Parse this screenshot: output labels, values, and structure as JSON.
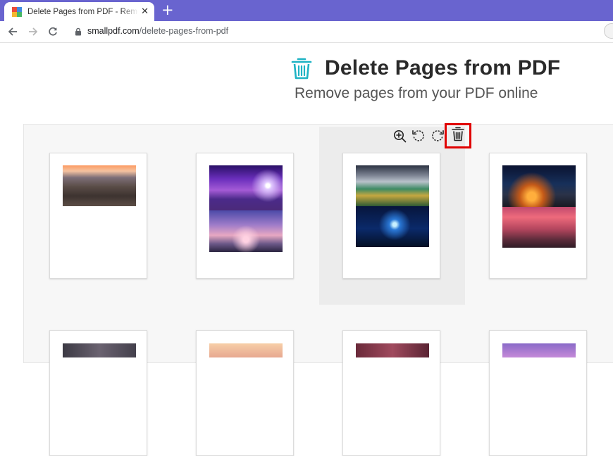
{
  "browser": {
    "tab": {
      "title": "Delete Pages from PDF - Remove",
      "favicon_colors": [
        "#e94b3c",
        "#3f8ae0",
        "#f2b630",
        "#46b765"
      ]
    },
    "new_tab_label": "+",
    "close_label": "✕",
    "address": {
      "domain": "smallpdf.com",
      "path": "/delete-pages-from-pdf"
    },
    "tab_strip_color": "#6964cf"
  },
  "page": {
    "title": "Delete Pages from PDF",
    "subtitle": "Remove pages from your PDF online",
    "accent_color": "#1fb3c4",
    "header_icon": "trash-icon"
  },
  "page_tools": {
    "icons": [
      "zoom-in-icon",
      "rotate-left-icon",
      "rotate-right-icon",
      "trash-icon"
    ],
    "highlight_color": "#e00000"
  },
  "pages": [
    {
      "icon": "landscape-photo",
      "photos": [
        "canyon-sunset"
      ]
    },
    {
      "icon": "landscape-photo",
      "photos": [
        "purple-sea-sunset",
        "pink-lake-rocks"
      ]
    },
    {
      "icon": "landscape-photo",
      "photos": [
        "cloudy-lake",
        "blue-starry-lake"
      ]
    },
    {
      "icon": "landscape-photo",
      "photos": [
        "tree-night-sky",
        "red-sunset-shore"
      ]
    }
  ]
}
